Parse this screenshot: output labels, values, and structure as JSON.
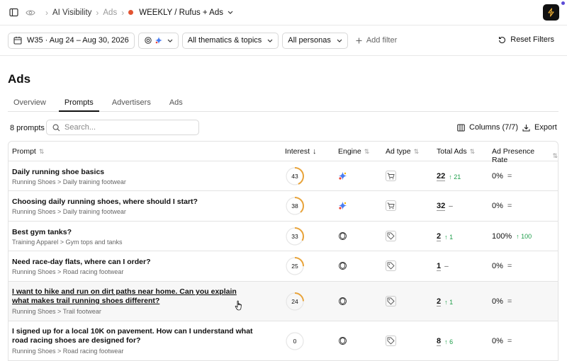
{
  "breadcrumb": {
    "section": "AI Visibility",
    "area": "Ads",
    "report": "WEEKLY / Rufus + Ads"
  },
  "filters": {
    "date_range": "W35 · Aug 24 – Aug 30, 2026",
    "topics": "All thematics & topics",
    "personas": "All personas",
    "add_filter": "Add filter",
    "reset": "Reset Filters"
  },
  "page_title": "Ads",
  "tabs": [
    {
      "label": "Overview",
      "active": false
    },
    {
      "label": "Prompts",
      "active": true
    },
    {
      "label": "Advertisers",
      "active": false
    },
    {
      "label": "Ads",
      "active": false
    }
  ],
  "toolbar": {
    "count": "8 prompts",
    "search_placeholder": "Search...",
    "columns": "Columns (7/7)",
    "export": "Export"
  },
  "table": {
    "headers": {
      "prompt": "Prompt",
      "interest": "Interest",
      "engine": "Engine",
      "ad_type": "Ad type",
      "total_ads": "Total Ads",
      "presence": "Ad Presence Rate"
    },
    "rows": [
      {
        "title": "Daily running shoe basics",
        "path": "Running Shoes > Daily training footwear",
        "interest": 43,
        "engine": "gemini-icon",
        "ad_type": "cart-icon",
        "total": "22",
        "delta": "21",
        "rate": "0%",
        "rate_delta": ""
      },
      {
        "title": "Choosing daily running shoes, where should I start?",
        "path": "Running Shoes > Daily training footwear",
        "interest": 38,
        "engine": "gemini-icon",
        "ad_type": "cart-icon",
        "total": "32",
        "delta": "",
        "rate": "0%",
        "rate_delta": ""
      },
      {
        "title": "Best gym tanks?",
        "path": "Training Apparel > Gym tops and tanks",
        "interest": 33,
        "engine": "openai-icon",
        "ad_type": "tag-icon",
        "total": "2",
        "delta": "1",
        "rate": "100%",
        "rate_delta": "100"
      },
      {
        "title": "Need race-day flats, where can I order?",
        "path": "Running Shoes > Road racing footwear",
        "interest": 25,
        "engine": "openai-icon",
        "ad_type": "tag-icon",
        "total": "1",
        "delta": "",
        "rate": "0%",
        "rate_delta": ""
      },
      {
        "title": "I want to hike and run on dirt paths near home. Can you explain what makes trail running shoes different?",
        "path": "Running Shoes > Trail footwear",
        "interest": 24,
        "engine": "openai-icon",
        "ad_type": "tag-icon",
        "total": "2",
        "delta": "1",
        "rate": "0%",
        "rate_delta": ""
      },
      {
        "title": "I signed up for a local 10K on pavement. How can I understand what road racing shoes are designed for?",
        "path": "Running Shoes > Road racing footwear",
        "interest": 0,
        "engine": "openai-icon",
        "ad_type": "tag-icon",
        "total": "8",
        "delta": "6",
        "rate": "0%",
        "rate_delta": ""
      }
    ]
  },
  "colors": {
    "accent_ring": "#e8a33a",
    "positive": "#1e9e4a",
    "status_dot": "#e25432"
  }
}
